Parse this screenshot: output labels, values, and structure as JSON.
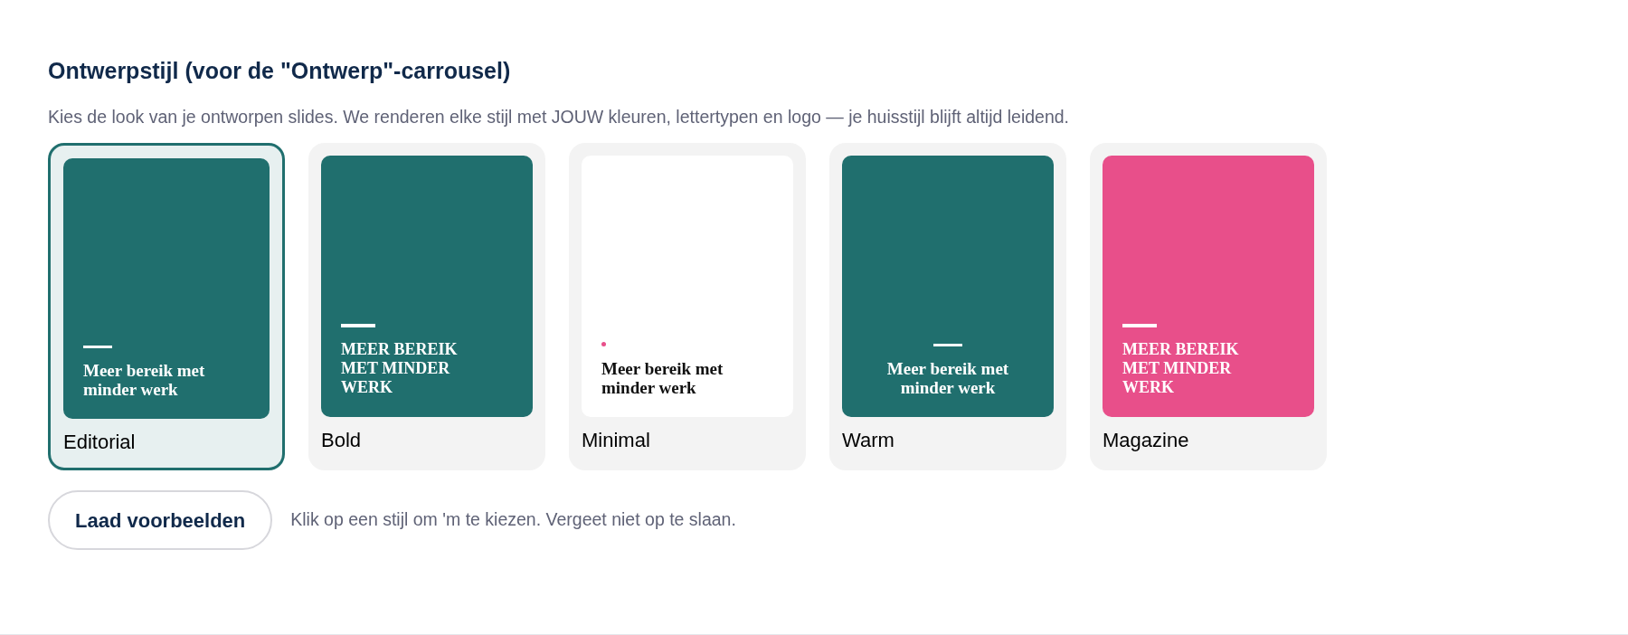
{
  "section": {
    "title": "Ontwerpstijl (voor de \"Ontwerp\"-carrousel)",
    "description": "Kies de look van je ontworpen slides. We renderen elke stijl met JOUW kleuren, lettertypen en logo — je huisstijl blijft altijd leidend."
  },
  "styles": [
    {
      "label": "Editorial",
      "kind": "editorial",
      "selected": true,
      "slide_text": "Meer bereik met minder werk"
    },
    {
      "label": "Bold",
      "kind": "bold",
      "selected": false,
      "slide_text": "MEER BEREIK MET MINDER WERK"
    },
    {
      "label": "Minimal",
      "kind": "minimal",
      "selected": false,
      "slide_text": "Meer bereik met minder werk"
    },
    {
      "label": "Warm",
      "kind": "warm",
      "selected": false,
      "slide_text": "Meer bereik met minder werk"
    },
    {
      "label": "Magazine",
      "kind": "magazine",
      "selected": false,
      "slide_text": "MEER BEREIK MET MINDER WERK"
    }
  ],
  "load_button": "Laad voorbeelden",
  "hint": "Klik op een stijl om 'm te kiezen. Vergeet niet op te slaan."
}
